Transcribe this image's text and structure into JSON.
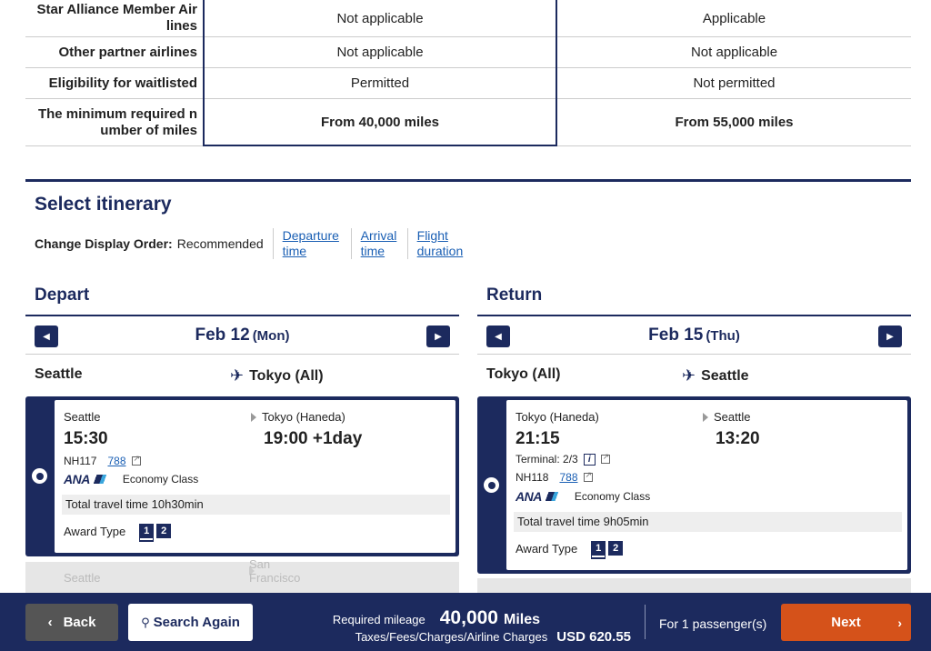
{
  "comparison": {
    "rows": [
      {
        "label": "Star Alliance Member Air lines",
        "col1": "Not applicable",
        "col2": "Applicable"
      },
      {
        "label": "Other partner airlines",
        "col1": "Not applicable",
        "col2": "Not applicable"
      },
      {
        "label": "Eligibility for waitlisted",
        "col1": "Permitted",
        "col2": "Not permitted"
      },
      {
        "label": "The minimum required n umber of miles",
        "col1": "From 40,000 miles",
        "col2": "From 55,000 miles"
      }
    ]
  },
  "itinerary": {
    "title": "Select itinerary",
    "order_label": "Change Display Order:",
    "order_current": "Recommended",
    "order_options": [
      "Departure time",
      "Arrival time",
      "Flight duration"
    ]
  },
  "depart": {
    "title": "Depart",
    "date": "Feb 12",
    "weekday": "(Mon)",
    "route_from": "Seattle",
    "route_to": "Tokyo (All)",
    "flight": {
      "from_city": "Seattle",
      "dep_time": "15:30",
      "to_city": "Tokyo (Haneda)",
      "arr_time": "19:00 +1day",
      "flight_no": "NH117",
      "aircraft": "788",
      "airline": "ANA",
      "cabin": "Economy Class",
      "travel_time": "Total travel time 10h30min",
      "award_label": "Award Type",
      "award_types": [
        "1",
        "2"
      ]
    },
    "next_flight": {
      "from_city": "Seattle",
      "to_city": "San Francisco"
    }
  },
  "return": {
    "title": "Return",
    "date": "Feb 15",
    "weekday": "(Thu)",
    "route_from": "Tokyo (All)",
    "route_to": "Seattle",
    "flight": {
      "from_city": "Tokyo (Haneda)",
      "dep_time": "21:15",
      "to_city": "Seattle",
      "arr_time": "13:20",
      "terminal": "Terminal: 2/3",
      "flight_no": "NH118",
      "aircraft": "788",
      "airline": "ANA",
      "cabin": "Economy Class",
      "travel_time": "Total travel time 9h05min",
      "award_label": "Award Type",
      "award_types": [
        "1",
        "2"
      ]
    }
  },
  "bottom": {
    "back_label": "Back",
    "search_label": "Search Again",
    "mileage_label": "Required mileage",
    "mileage_value": "40,000",
    "mileage_unit": "Miles",
    "taxes_label": "Taxes/Fees/Charges/Airline Charges",
    "taxes_value": "USD  620.55",
    "passengers": "For 1 passenger(s)",
    "next_label": "Next"
  },
  "colors": {
    "brand": "#1c2a5e",
    "next": "#d5521a",
    "link": "#1a5fb4"
  }
}
